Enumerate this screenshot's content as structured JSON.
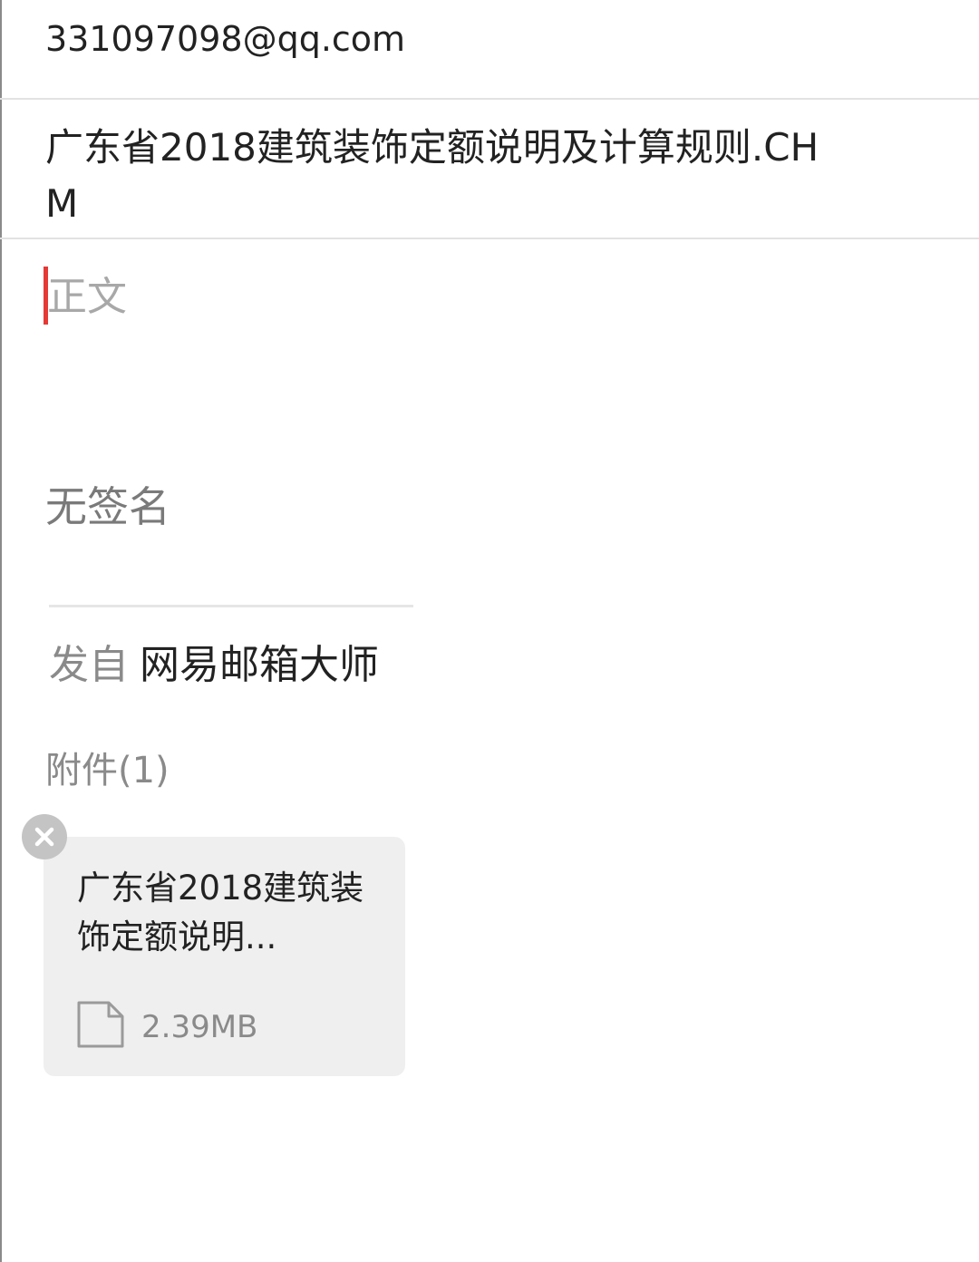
{
  "compose": {
    "to": "331097098@qq.com",
    "subject": "广东省2018建筑装饰定额说明及计算规则.CHM",
    "body_placeholder": "正文",
    "signature": "无签名",
    "sent_from_prefix": "发自",
    "sent_from_app": "网易邮箱大师"
  },
  "attachments": {
    "label": "附件(1)",
    "items": [
      {
        "name": "广东省2018建筑装饰定额说明...",
        "size": "2.39MB",
        "icon": "file-icon",
        "remove_icon": "close-icon"
      }
    ]
  },
  "colors": {
    "cursor": "#e53935",
    "card_bg": "#efefef",
    "divider": "#e2e2e2"
  }
}
